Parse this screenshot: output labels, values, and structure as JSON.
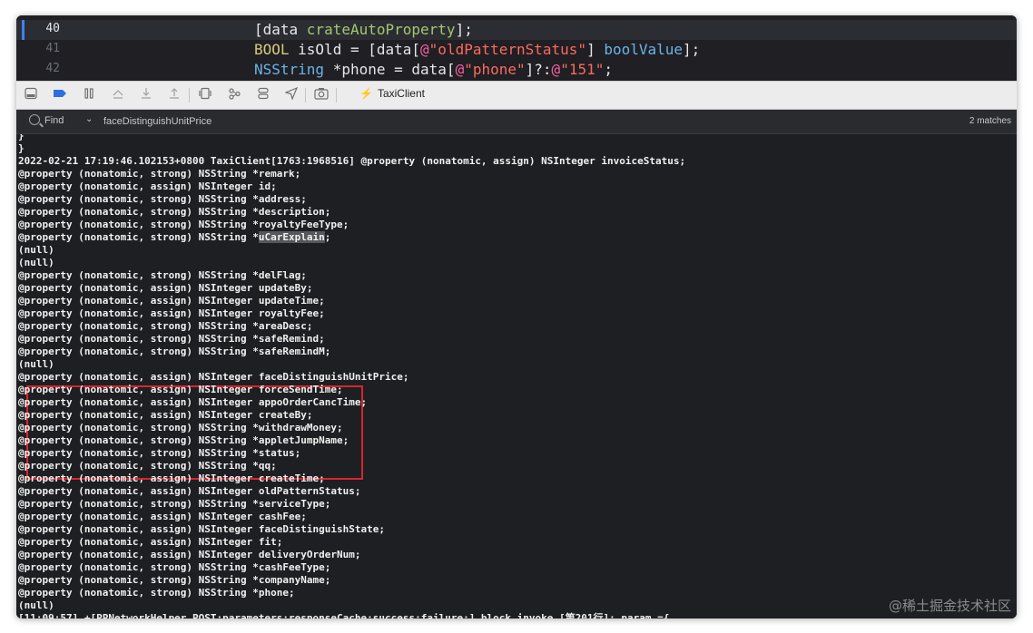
{
  "editor": {
    "lines": [
      {
        "number": "40",
        "current": true,
        "tokens": [
          {
            "t": "[data ",
            "c": "c-plain"
          },
          {
            "t": "crateAutoProperty",
            "c": "c-method"
          },
          {
            "t": "];",
            "c": "c-plain"
          }
        ]
      },
      {
        "number": "41",
        "current": false,
        "tokens": [
          {
            "t": "BOOL",
            "c": "c-type"
          },
          {
            "t": " isOld = [data[",
            "c": "c-plain"
          },
          {
            "t": "@",
            "c": "c-at"
          },
          {
            "t": "\"oldPatternStatus\"",
            "c": "c-str"
          },
          {
            "t": "] ",
            "c": "c-plain"
          },
          {
            "t": "boolValue",
            "c": "c-kw2"
          },
          {
            "t": "];",
            "c": "c-plain"
          }
        ]
      },
      {
        "number": "42",
        "current": false,
        "tokens": [
          {
            "t": "NSString",
            "c": "c-type2"
          },
          {
            "t": " *phone = data[",
            "c": "c-plain"
          },
          {
            "t": "@",
            "c": "c-at"
          },
          {
            "t": "\"phone\"",
            "c": "c-str"
          },
          {
            "t": "]?:",
            "c": "c-plain"
          },
          {
            "t": "@",
            "c": "c-at"
          },
          {
            "t": "\"151\"",
            "c": "c-str"
          },
          {
            "t": ";",
            "c": "c-plain"
          }
        ]
      }
    ]
  },
  "toolbar": {
    "buttons": [
      "hide-console-icon",
      "breakpoints-icon",
      "pause-icon",
      "step-over-icon",
      "step-into-icon",
      "step-out-icon",
      "view-hierarchy-icon",
      "memory-graph-icon",
      "environment-icon",
      "location-icon",
      "camera-icon"
    ],
    "target": "TaxiClient"
  },
  "find": {
    "label": "Find",
    "query": "faceDistinguishUnitPrice",
    "matches": "2 matches"
  },
  "console": {
    "lines": [
      "}",
      "}",
      "2022-02-21 17:19:46.102153+0800 TaxiClient[1763:1968516] @property (nonatomic, assign) NSInteger invoiceStatus;",
      "@property (nonatomic, strong) NSString *remark;",
      "@property (nonatomic, assign) NSInteger id;",
      "@property (nonatomic, strong) NSString *address;",
      "@property (nonatomic, strong) NSString *description;",
      "@property (nonatomic, strong) NSString *royaltyFeeType;",
      "@property (nonatomic, strong) NSString *",
      "(null)",
      "(null)",
      "@property (nonatomic, strong) NSString *delFlag;",
      "@property (nonatomic, assign) NSInteger updateBy;",
      "@property (nonatomic, assign) NSInteger updateTime;",
      "@property (nonatomic, assign) NSInteger royaltyFee;",
      "@property (nonatomic, strong) NSString *areaDesc;",
      "@property (nonatomic, strong) NSString *safeRemind;",
      "@property (nonatomic, strong) NSString *safeRemindM;",
      "(null)",
      "@property (nonatomic, assign) NSInteger faceDistinguishUnitPrice;",
      "@property (nonatomic, assign) NSInteger forceSendTime;",
      "@property (nonatomic, assign) NSInteger appoOrderCancTime;",
      "@property (nonatomic, assign) NSInteger createBy;",
      "@property (nonatomic, strong) NSString *withdrawMoney;",
      "@property (nonatomic, strong) NSString *appletJumpName;",
      "@property (nonatomic, strong) NSString *status;",
      "@property (nonatomic, strong) NSString *qq;",
      "@property (nonatomic, assign) NSInteger createTime;",
      "@property (nonatomic, assign) NSInteger oldPatternStatus;",
      "@property (nonatomic, strong) NSString *serviceType;",
      "@property (nonatomic, assign) NSInteger cashFee;",
      "@property (nonatomic, assign) NSInteger faceDistinguishState;",
      "@property (nonatomic, assign) NSInteger fit;",
      "@property (nonatomic, assign) NSInteger deliveryOrderNum;",
      "@property (nonatomic, strong) NSString *cashFeeType;",
      "@property (nonatomic, strong) NSString *companyName;",
      "@property (nonatomic, strong) NSString *phone;",
      "(null)",
      "[11:09:57] +[PPNetworkHelper POST:parameters:responseCache:success:failure:]_block_invoke [第201行]: param ={"
    ],
    "highlight": {
      "line": 8,
      "text": "uCarExplain",
      "suffix": ";"
    }
  },
  "watermark": "@稀土掘金技术社区"
}
